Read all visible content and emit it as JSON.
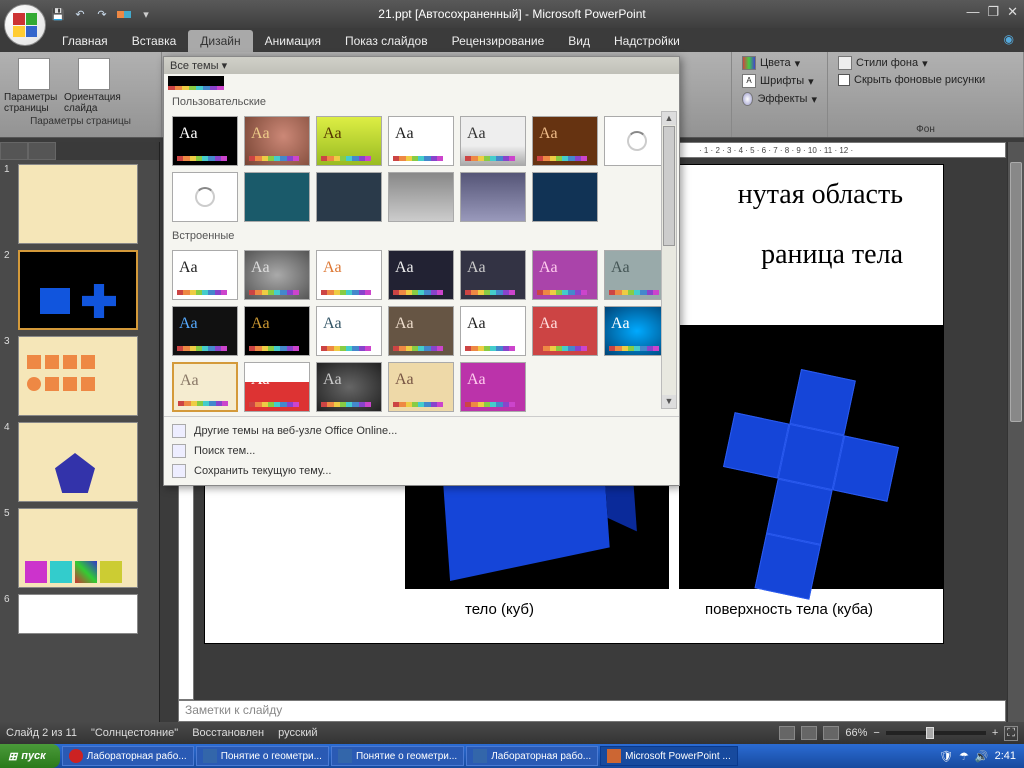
{
  "title": "21.ppt [Автосохраненный] - Microsoft PowerPoint",
  "qat": {
    "save": "💾",
    "undo": "↶",
    "redo": "↷"
  },
  "tabs": {
    "home": "Главная",
    "insert": "Вставка",
    "design": "Дизайн",
    "animation": "Анимация",
    "slideshow": "Показ слайдов",
    "review": "Рецензирование",
    "view": "Вид",
    "addins": "Надстройки"
  },
  "ribbon": {
    "page_params": "Параметры страницы",
    "orientation": "Ориентация слайда",
    "group_page": "Параметры страницы",
    "colors": "Цвета",
    "fonts": "Шрифты",
    "effects": "Эффекты",
    "bg_styles": "Стили фона",
    "hide_bg": "Скрыть фоновые рисунки",
    "group_bg": "Фон"
  },
  "themes": {
    "all": "Все темы",
    "custom": "Пользовательские",
    "builtin": "Встроенные",
    "more_online": "Другие темы на веб-узле Office Online...",
    "search": "Поиск тем...",
    "save_current": "Сохранить текущую тему..."
  },
  "slide": {
    "text1": "нутая область",
    "text2": "раница тела",
    "caption1": "тело (куб)",
    "caption2": "поверхность тела (куба)"
  },
  "notes_placeholder": "Заметки к слайду",
  "status": {
    "slide": "Слайд 2 из 11",
    "theme": "\"Солнцестояние\"",
    "recovered": "Восстановлен",
    "lang": "русский",
    "zoom": "66%"
  },
  "taskbar": {
    "start": "пуск",
    "items": [
      "Лабораторная рабо...",
      "Понятие о геометри...",
      "Понятие о геометри...",
      "Лабораторная рабо...",
      "Microsoft PowerPoint ..."
    ],
    "clock": "2:41"
  },
  "slide_nums": [
    "1",
    "2",
    "3",
    "4",
    "5",
    "6"
  ],
  "ruler_right": "· 1 · 2 · 3 · 4 · 5 · 6 · 7 · 8 · 9 · 10 · 11 · 12 ·"
}
